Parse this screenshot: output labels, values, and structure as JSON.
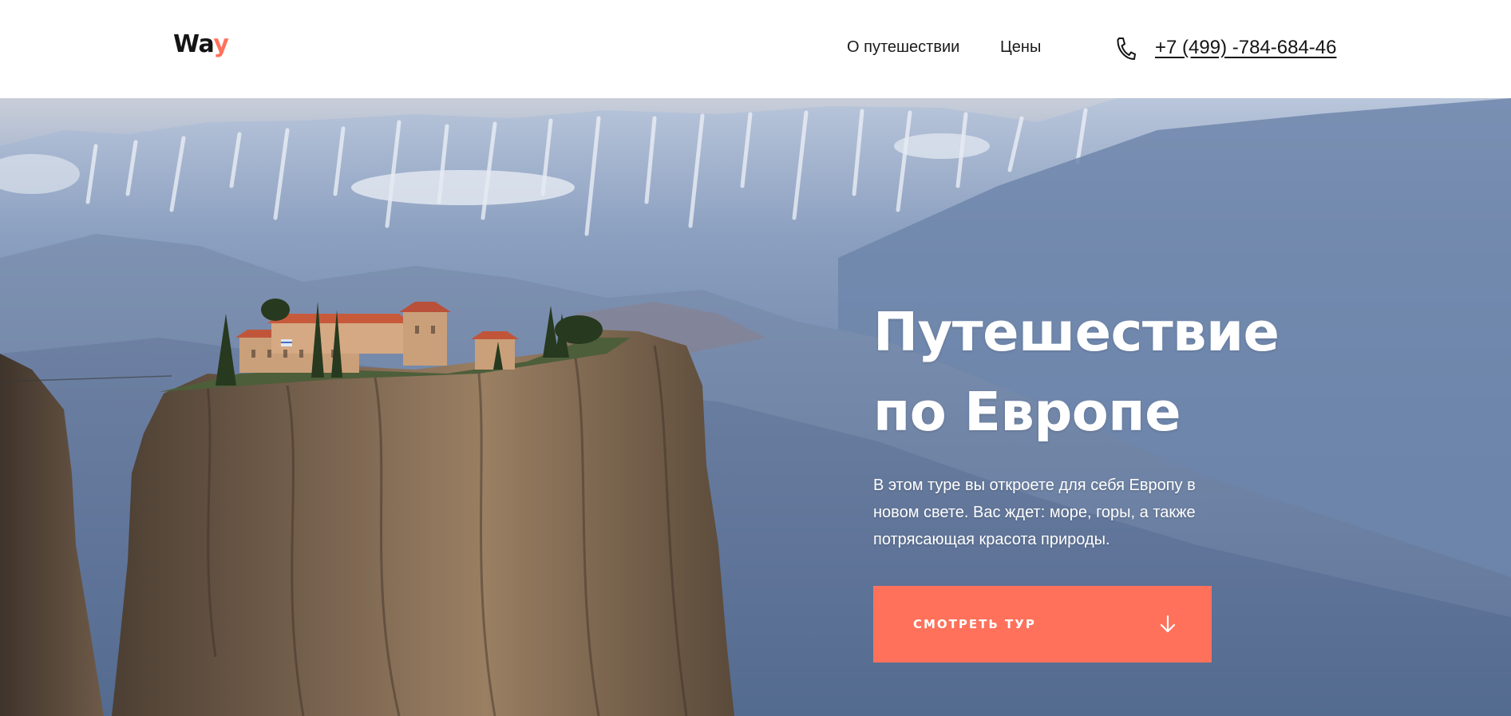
{
  "header": {
    "logo_text": "Wa",
    "logo_accent": "y",
    "nav": [
      {
        "label": "О путешествии"
      },
      {
        "label": "Цены"
      }
    ],
    "phone_icon": "phone-icon",
    "phone": "+7 (499) -784-684-46"
  },
  "hero": {
    "title_line1": "Путешествие",
    "title_line2": "по Европе",
    "description": "В этом туре вы откроете для себя Европу в новом свете. Вас ждет: море, горы, а также потрясающая красота природы.",
    "cta_label": "СМОТРЕТЬ ТУР",
    "cta_icon": "arrow-down-icon"
  },
  "colors": {
    "accent": "#ff715b",
    "text_dark": "#141414",
    "background": "#ffffff"
  }
}
